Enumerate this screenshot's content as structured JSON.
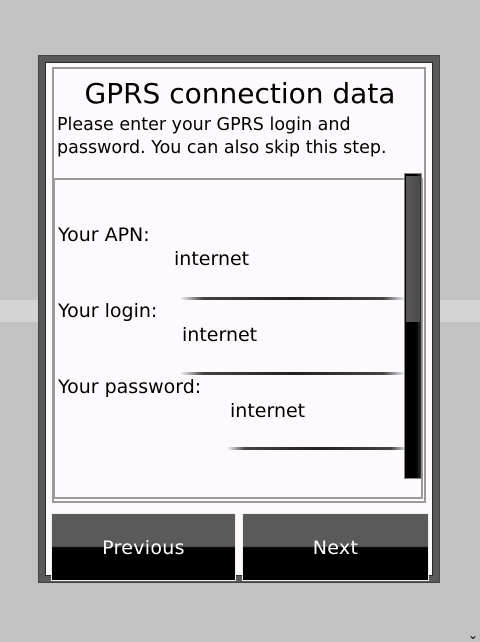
{
  "dialog": {
    "title": "GPRS connection data",
    "description": "Please enter your GPRS login and password. You can also skip this step."
  },
  "fields": [
    {
      "label": "Your APN:",
      "value": "internet"
    },
    {
      "label": "Your login:",
      "value": "internet"
    },
    {
      "label": "Your password:",
      "value": "internet"
    }
  ],
  "buttons": {
    "previous": "Previous",
    "next": "Next"
  },
  "scrollbar": {
    "position_fraction": 0.0,
    "visible_fraction": 0.48
  },
  "icons": {
    "corner": "chevron-down-icon"
  },
  "colors": {
    "background": "#c2c2c2",
    "panel": "#fdf9fd",
    "button_top": "#5a5a5a",
    "button_bottom": "#000000",
    "button_text": "#ffffff"
  }
}
